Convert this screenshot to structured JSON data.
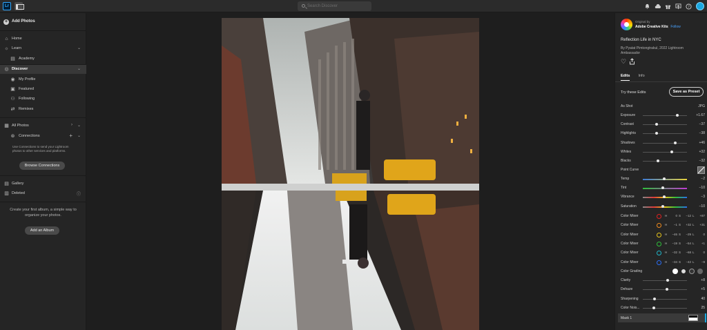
{
  "topbar": {
    "logo": "Lr",
    "search_placeholder": "Search Discover",
    "icons": [
      "bell-icon",
      "cloud-icon",
      "gift-icon",
      "share-screen-icon",
      "help-icon",
      "avatar"
    ]
  },
  "sidebar": {
    "add_photos": "Add Photos",
    "home": "Home",
    "learn": "Learn",
    "academy": "Academy",
    "discover": "Discover",
    "my_profile": "My Profile",
    "featured": "Featured",
    "following": "Following",
    "remixes": "Remixes",
    "all_photos": "All Photos",
    "connections": "Connections",
    "connections_note": "Use Connections to send your Lightroom photos to other services and platforms.",
    "browse_connections": "Browse Connections",
    "gallery": "Gallery",
    "deleted": "Deleted",
    "album_note": "Create your first album, a simple way to organize your photos.",
    "add_album": "Add an Album"
  },
  "right": {
    "original_by": "Original by",
    "author": "Adobe Creative Kits",
    "follow": "Follow",
    "title": "Reflection Life in NYC",
    "byline": "By Pyatat Pimtongtrakul, 2022 Lightroom Ambassador",
    "tabs": [
      "Edits",
      "Info"
    ],
    "try_edits": "Try these Edits",
    "save_preset": "Save as Preset",
    "as_shot": "As Shot",
    "as_shot_val": "JPG",
    "sliders": [
      {
        "name": "Exposure",
        "val": "+1.67",
        "pos": 0.78
      },
      {
        "name": "Contrast",
        "val": "−37",
        "pos": 0.31
      },
      {
        "name": "Highlights",
        "val": "−38",
        "pos": 0.31
      },
      {
        "name": "Shadows",
        "val": "+46",
        "pos": 0.73
      },
      {
        "name": "Whites",
        "val": "+32",
        "pos": 0.66
      },
      {
        "name": "Blacks",
        "val": "−32",
        "pos": 0.34
      }
    ],
    "point_curve": "Point Curve",
    "temp_tint": [
      {
        "name": "Temp",
        "val": "−2",
        "pos": 0.49,
        "kind": "temp"
      },
      {
        "name": "Tint",
        "val": "−10",
        "pos": 0.45,
        "kind": "tint"
      },
      {
        "name": "Vibrance",
        "val": "−3",
        "pos": 0.49,
        "kind": "sat"
      },
      {
        "name": "Saturation",
        "val": "−10",
        "pos": 0.45,
        "kind": "sat"
      }
    ],
    "color_mixers": [
      {
        "name": "Color Mixer",
        "color": "#e02020",
        "h": "0",
        "s": "−12",
        "l": "+87"
      },
      {
        "name": "Color Mixer",
        "color": "#f08a1c",
        "h": "−1",
        "s": "+32",
        "l": "+31"
      },
      {
        "name": "Color Mixer",
        "color": "#e8c51a",
        "h": "−46",
        "s": "−29",
        "l": "0"
      },
      {
        "name": "Color Mixer",
        "color": "#2fbf3a",
        "h": "−19",
        "s": "−54",
        "l": "+1"
      },
      {
        "name": "Color Mixer",
        "color": "#1fb5c9",
        "h": "−32",
        "s": "−68",
        "l": "0"
      },
      {
        "name": "Color Mixer",
        "color": "#2a6df5",
        "h": "−34",
        "s": "−42",
        "l": "−9"
      }
    ],
    "color_grading": "Color Grading",
    "detail": [
      {
        "name": "Clarity",
        "val": "+8",
        "pos": 0.56
      },
      {
        "name": "Dehaze",
        "val": "+5",
        "pos": 0.54
      },
      {
        "name": "Sharpening",
        "val": "40",
        "pos": 0.27
      },
      {
        "name": "Color Nois...",
        "val": "25",
        "pos": 0.25
      }
    ],
    "mask": "Mask 1"
  }
}
